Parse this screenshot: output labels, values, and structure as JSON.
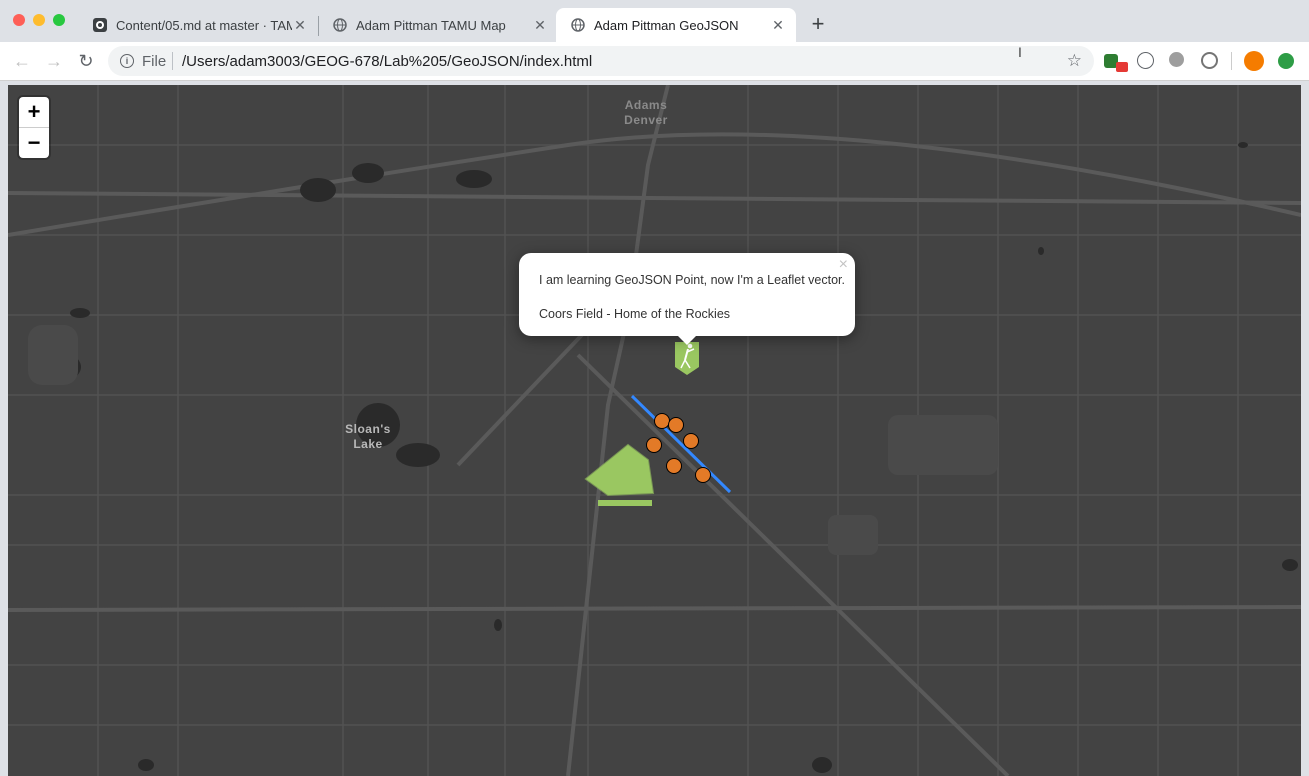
{
  "tabs": [
    {
      "label": "Content/05.md at master · TAMU",
      "icon": "github-icon"
    },
    {
      "label": "Adam Pittman TAMU Map",
      "icon": "globe-icon"
    },
    {
      "label": "Adam Pittman GeoJSON",
      "icon": "globe-icon",
      "active": true
    }
  ],
  "address": {
    "protocol": "File",
    "url": "/Users/adam3003/GEOG-678/Lab%205/GeoJSON/index.html"
  },
  "map": {
    "zoom_in": "+",
    "zoom_out": "−",
    "labels": {
      "sloans_lake": "Sloan's\nLake",
      "adams_denver": "Adams\nDenver"
    },
    "popup": {
      "close": "×",
      "line1": "I am learning GeoJSON Point, now I'm a Leaflet vector.",
      "line2": "Coors Field - Home of the Rockies"
    },
    "colors": {
      "background": "#434343",
      "polygon": "#9ac761",
      "marker_fill": "#e37a27",
      "line": "#3388ff"
    }
  }
}
